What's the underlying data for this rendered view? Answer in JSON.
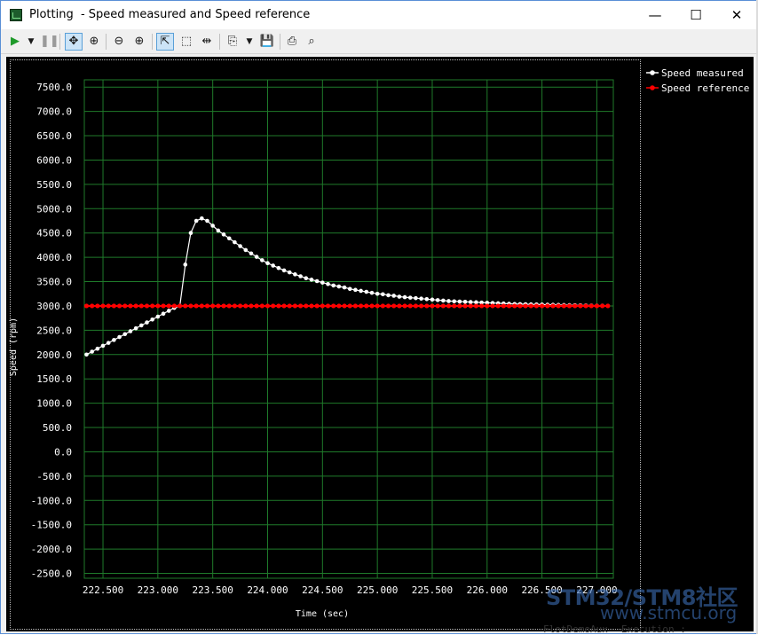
{
  "window": {
    "title": "Plotting  - Speed measured and Speed reference",
    "minimize": "—",
    "maximize": "☐",
    "close": "✕"
  },
  "toolbar": {
    "icons": [
      "play-icon",
      "dropdown-arrow-icon",
      "pause-icon",
      "pan-icon",
      "zoom-fit-icon",
      "zoom-out-icon",
      "zoom-in-icon",
      "select-pointer-icon",
      "rect-select-icon",
      "cursor-marker-icon",
      "copy-icon",
      "dropdown-arrow-icon",
      "save-icon",
      "print-icon",
      "print-preview-icon"
    ]
  },
  "colors": {
    "background": "#000000",
    "grid": "#1f7a2a",
    "axis_text": "#ffffff",
    "speed_measured": "#ffffff",
    "speed_reference": "#ff0000"
  },
  "background_text": {
    "bottom_left": "Execution : ",
    "bottom_mid": "FlotDemoAux",
    "watermark_main": "STM32/STM8社区",
    "watermark_url": "www.stmcu.org"
  },
  "chart_data": {
    "type": "line",
    "title": "",
    "xlabel": "Time (sec)",
    "ylabel": "Speed (rpm)",
    "xlim": [
      222.33,
      227.15
    ],
    "ylim": [
      -2600,
      7650
    ],
    "x_ticks": [
      "222.500",
      "223.000",
      "223.500",
      "224.000",
      "224.500",
      "225.000",
      "225.500",
      "226.000",
      "226.500",
      "227.000"
    ],
    "y_ticks": [
      "7500.0",
      "7000.0",
      "6500.0",
      "6000.0",
      "5500.0",
      "5000.0",
      "4500.0",
      "4000.0",
      "3500.0",
      "3000.0",
      "2500.0",
      "2000.0",
      "1500.0",
      "1000.0",
      "500.0",
      "0.0",
      "-500.0",
      "-1000.0",
      "-1500.0",
      "-2000.0",
      "-2500.0"
    ],
    "grid": true,
    "legend_position": "right",
    "series": [
      {
        "name": "Speed measured",
        "color": "#ffffff",
        "x": [
          222.35,
          222.4,
          222.45,
          222.5,
          222.55,
          222.6,
          222.65,
          222.7,
          222.75,
          222.8,
          222.85,
          222.9,
          222.95,
          223.0,
          223.05,
          223.1,
          223.15,
          223.2,
          223.25,
          223.3,
          223.35,
          223.4,
          223.45,
          223.5,
          223.55,
          223.6,
          223.65,
          223.7,
          223.75,
          223.8,
          223.85,
          223.9,
          223.95,
          224.0,
          224.05,
          224.1,
          224.15,
          224.2,
          224.25,
          224.3,
          224.35,
          224.4,
          224.45,
          224.5,
          224.55,
          224.6,
          224.65,
          224.7,
          224.75,
          224.8,
          224.85,
          224.9,
          224.95,
          225.0,
          225.05,
          225.1,
          225.15,
          225.2,
          225.25,
          225.3,
          225.35,
          225.4,
          225.45,
          225.5,
          225.55,
          225.6,
          225.65,
          225.7,
          225.75,
          225.8,
          225.85,
          225.9,
          225.95,
          226.0,
          226.05,
          226.1,
          226.15,
          226.2,
          226.25,
          226.3,
          226.35,
          226.4,
          226.45,
          226.5,
          226.55,
          226.6,
          226.65,
          226.7,
          226.75,
          226.8,
          226.85,
          226.9,
          226.95,
          227.0,
          227.05,
          227.1
        ],
        "y": [
          2000,
          2060,
          2120,
          2180,
          2240,
          2300,
          2360,
          2420,
          2480,
          2540,
          2600,
          2660,
          2720,
          2780,
          2840,
          2900,
          2960,
          3000,
          3850,
          4500,
          4750,
          4800,
          4750,
          4650,
          4550,
          4470,
          4390,
          4310,
          4230,
          4150,
          4080,
          4010,
          3940,
          3880,
          3830,
          3780,
          3730,
          3690,
          3650,
          3610,
          3570,
          3540,
          3510,
          3480,
          3450,
          3420,
          3400,
          3380,
          3350,
          3330,
          3310,
          3290,
          3270,
          3250,
          3240,
          3220,
          3210,
          3190,
          3180,
          3170,
          3160,
          3150,
          3140,
          3130,
          3120,
          3110,
          3100,
          3095,
          3090,
          3085,
          3080,
          3075,
          3070,
          3065,
          3060,
          3055,
          3050,
          3045,
          3040,
          3038,
          3035,
          3032,
          3030,
          3028,
          3025,
          3023,
          3020,
          3018,
          3016,
          3014,
          3012,
          3010,
          3008,
          3006,
          3004,
          3002
        ]
      },
      {
        "name": "Speed reference",
        "color": "#ff0000",
        "x": [
          222.35,
          227.1
        ],
        "y": [
          3000,
          3000
        ]
      }
    ]
  }
}
